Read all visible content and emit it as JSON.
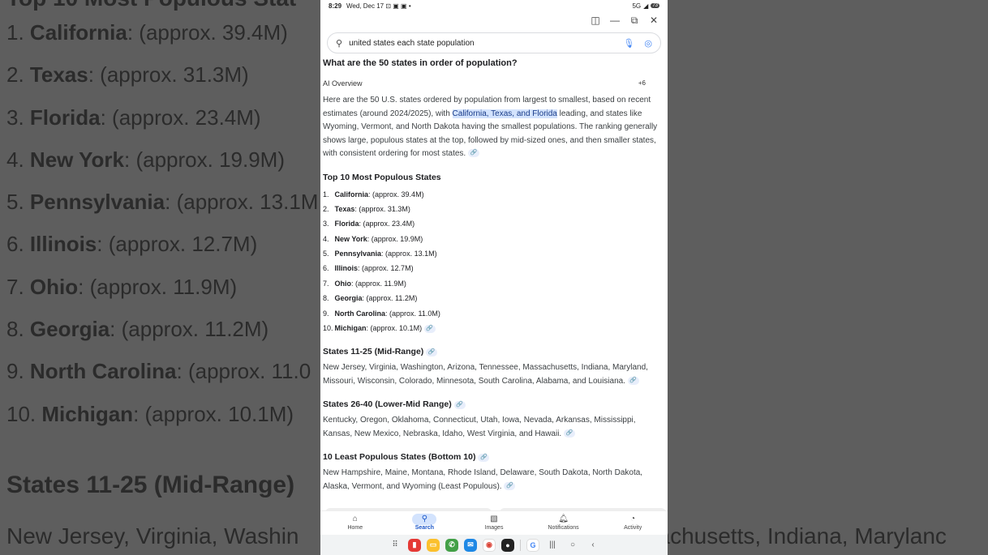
{
  "background": {
    "top_partial": "Top 10 Most Populous Stat",
    "list": [
      {
        "num": "1.",
        "state": "California",
        "rest": ": (approx. 39.4M)"
      },
      {
        "num": "2.",
        "state": "Texas",
        "rest": ": (approx. 31.3M)"
      },
      {
        "num": "3.",
        "state": "Florida",
        "rest": ": (approx. 23.4M)"
      },
      {
        "num": "4.",
        "state": "New York",
        "rest": ": (approx. 19.9M)"
      },
      {
        "num": "5.",
        "state": "Pennsylvania",
        "rest": ": (approx. 13.1M"
      },
      {
        "num": "6.",
        "state": "Illinois",
        "rest": ": (approx. 12.7M)"
      },
      {
        "num": "7.",
        "state": "Ohio",
        "rest": ": (approx. 11.9M)"
      },
      {
        "num": "8.",
        "state": "Georgia",
        "rest": ": (approx. 11.2M)"
      },
      {
        "num": "9.",
        "state": "North Carolina",
        "rest": ": (approx. 11.0"
      },
      {
        "num": "10.",
        "state": "Michigan",
        "rest": ": (approx. 10.1M)"
      }
    ],
    "section_title": "States 11-25 (Mid-Range)",
    "line_left": "New Jersey, Virginia, Washin",
    "line_right": "sachusetts, Indiana, Marylanc"
  },
  "status": {
    "time": "8:29",
    "date": "Wed, Dec 17",
    "signal": "5G",
    "battery": "73"
  },
  "search": {
    "query": "united states each state population"
  },
  "question": "What are the 50 states in order of population?",
  "ai_overview": {
    "label": "AI Overview",
    "sources": "+6"
  },
  "intro": {
    "part1": "Here are the 50 U.S. states ordered by population from largest to smallest, based on recent estimates (around 2024/2025), with ",
    "highlight": "California, Texas, and Florida",
    "part2": " leading, and states like Wyoming, Vermont, and North Dakota having the smallest populations. The ranking generally shows large, populous states at the top, followed by mid-sized ones, and then smaller states, with consistent ordering for most states."
  },
  "top10": {
    "title": "Top 10 Most Populous States",
    "items": [
      {
        "num": "1.",
        "state": "California",
        "value": ": (approx. 39.4M)"
      },
      {
        "num": "2.",
        "state": "Texas",
        "value": ": (approx. 31.3M)"
      },
      {
        "num": "3.",
        "state": "Florida",
        "value": ": (approx. 23.4M)"
      },
      {
        "num": "4.",
        "state": "New York",
        "value": ": (approx. 19.9M)"
      },
      {
        "num": "5.",
        "state": "Pennsylvania",
        "value": ": (approx. 13.1M)"
      },
      {
        "num": "6.",
        "state": "Illinois",
        "value": ": (approx. 12.7M)"
      },
      {
        "num": "7.",
        "state": "Ohio",
        "value": ": (approx. 11.9M)"
      },
      {
        "num": "8.",
        "state": "Georgia",
        "value": ": (approx. 11.2M)"
      },
      {
        "num": "9.",
        "state": "North Carolina",
        "value": ": (approx. 11.0M)"
      },
      {
        "num": "10.",
        "state": "Michigan",
        "value": ": (approx. 10.1M)"
      }
    ]
  },
  "sections": [
    {
      "title": "States 11-25 (Mid-Range)",
      "line1": "New Jersey, Virginia, Washington, Arizona, Tennessee, Massachusetts, Indiana, Maryland,",
      "line2": "Missouri, Wisconsin, Colorado, Minnesota, South Carolina, Alabama, and Louisiana."
    },
    {
      "title": "States 26-40 (Lower-Mid Range)",
      "line1": "Kentucky, Oregon, Oklahoma, Connecticut, Utah, Iowa, Nevada, Arkansas, Mississippi,",
      "line2": "Kansas, New Mexico, Nebraska, Idaho, West Virginia, and Hawaii."
    },
    {
      "title": "10 Least Populous States (Bottom 10)",
      "line1": "New Hampshire, Maine, Montana, Rhode Island, Delaware, South Dakota, North Dakota,",
      "line2": "Alaska, Vermont, and Wyoming (Least Populous)."
    }
  ],
  "nav": {
    "home": "Home",
    "search": "Search",
    "images": "Images",
    "notifications": "Notifications",
    "activity": "Activity"
  },
  "dock": {
    "google": "G"
  },
  "colors": {
    "accent": "#1a56c9",
    "highlight_bg": "#d3e3fd"
  }
}
